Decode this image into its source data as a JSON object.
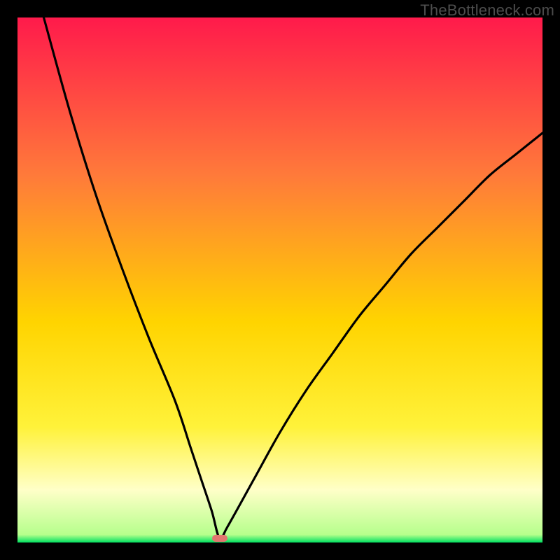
{
  "watermark_text": "TheBottleneck.com",
  "colors": {
    "frame": "#000000",
    "grad_top": "#ff1a4b",
    "grad_mid_upper": "#ff7a3a",
    "grad_mid": "#ffd400",
    "grad_mid_lower": "#fff23a",
    "grad_pale": "#ffffc8",
    "grad_green": "#00e060",
    "curve": "#000000",
    "marker": "#e2766f",
    "watermark": "#4d4d4d"
  },
  "chart_data": {
    "type": "line",
    "title": "",
    "xlabel": "",
    "ylabel": "",
    "xlim": [
      0,
      100
    ],
    "ylim": [
      0,
      100
    ],
    "series": [
      {
        "name": "curve",
        "x": [
          5,
          10,
          15,
          20,
          25,
          30,
          33,
          35,
          37,
          38.5,
          40,
          45,
          50,
          55,
          60,
          65,
          70,
          75,
          80,
          85,
          90,
          95,
          100
        ],
        "y": [
          100,
          82,
          66,
          52,
          39,
          27,
          18,
          12,
          6,
          0.8,
          3,
          12,
          21,
          29,
          36,
          43,
          49,
          55,
          60,
          65,
          70,
          74,
          78
        ]
      }
    ],
    "marker": {
      "x": 38.5,
      "y": 0.8,
      "width_pct": 3.0,
      "height_pct": 1.4
    },
    "gradient_stops": [
      {
        "offset": 0.0,
        "color": "#ff1a4b"
      },
      {
        "offset": 0.3,
        "color": "#ff7a3a"
      },
      {
        "offset": 0.58,
        "color": "#ffd400"
      },
      {
        "offset": 0.78,
        "color": "#fff23a"
      },
      {
        "offset": 0.9,
        "color": "#ffffc8"
      },
      {
        "offset": 0.985,
        "color": "#b6ff8c"
      },
      {
        "offset": 1.0,
        "color": "#00e060"
      }
    ]
  }
}
